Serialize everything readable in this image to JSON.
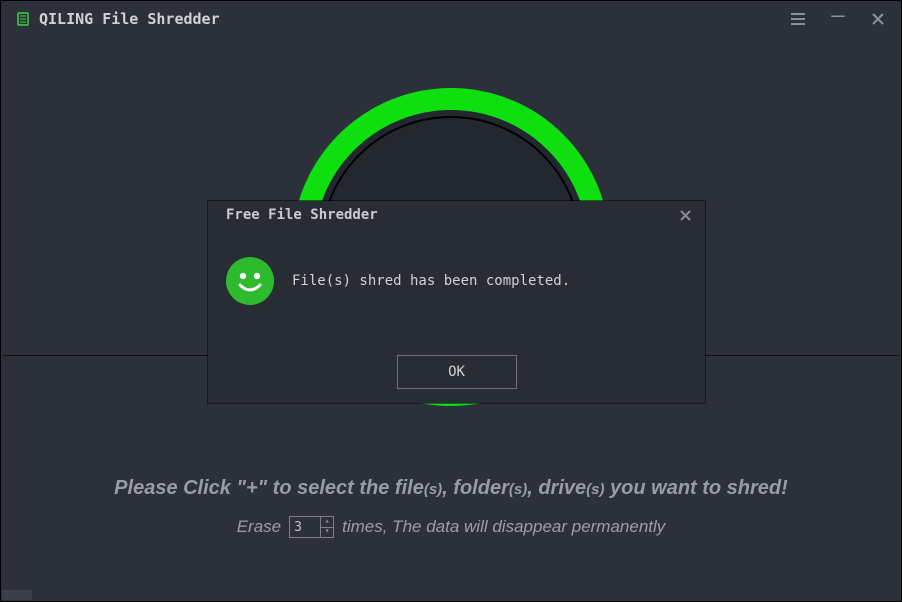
{
  "app": {
    "title": "QILING File Shredder"
  },
  "progress": {
    "percent": 100
  },
  "instruction": {
    "prefix": "Please Click \"+\" to select the file",
    "s1": "(s)",
    "mid1": ", folder",
    "s2": "(s)",
    "mid2": ", drive",
    "s3": "(s)",
    "suffix": " you want to shred!"
  },
  "erase": {
    "prefix": "Erase",
    "value": "3",
    "suffix": "times, The data will disappear permanently"
  },
  "dialog": {
    "title": "Free File Shredder",
    "message": "File(s) shred has been completed.",
    "ok": "OK"
  }
}
